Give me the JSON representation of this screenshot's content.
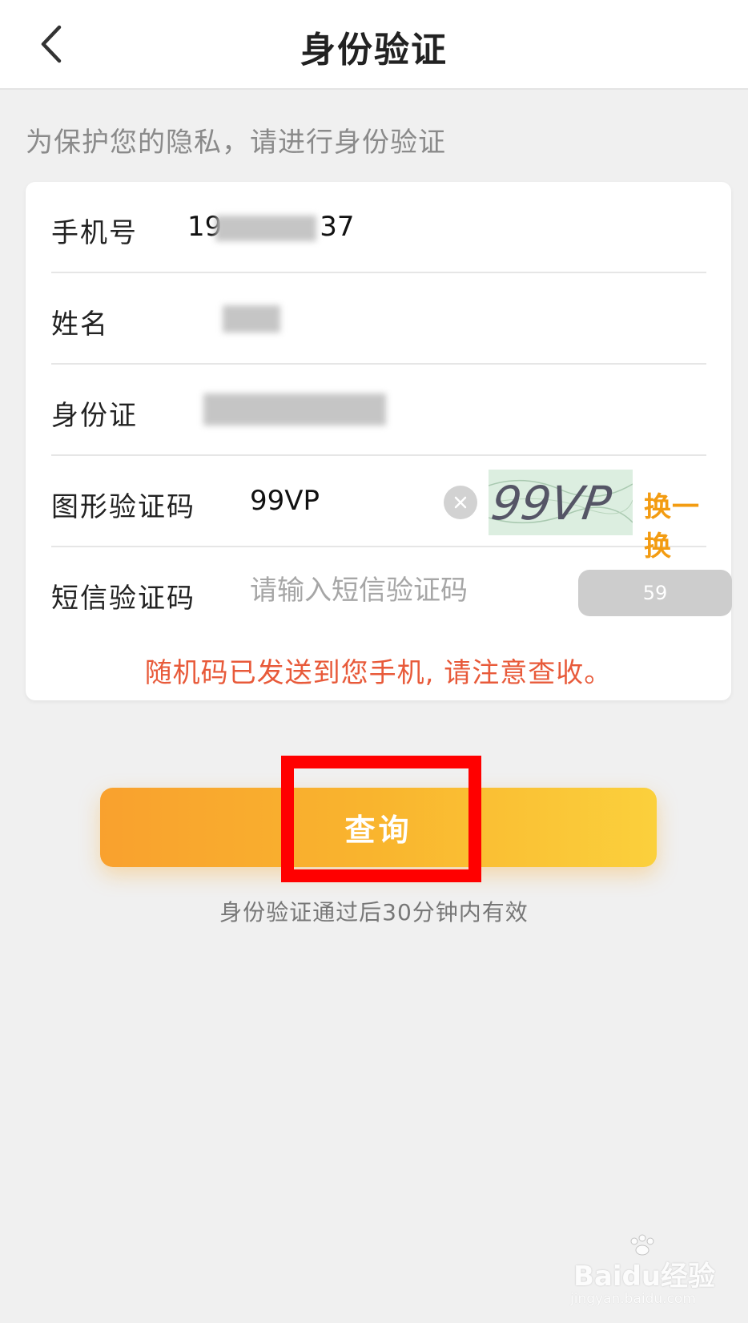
{
  "navbar": {
    "title": "身份验证",
    "back_icon": "chevron-left-icon"
  },
  "subtitle": "为保护您的隐私，请进行身份验证",
  "form": {
    "phone": {
      "label": "手机号",
      "value_prefix": "19",
      "value_suffix": "37"
    },
    "name": {
      "label": "姓名"
    },
    "id_card": {
      "label": "身份证"
    },
    "captcha": {
      "label": "图形验证码",
      "value": "99VP",
      "clear_icon": "clear-icon",
      "image_text": "99VP",
      "refresh_label": "换一换"
    },
    "sms": {
      "label": "短信验证码",
      "placeholder": "请输入短信验证码",
      "countdown": "59"
    },
    "sent_message": "随机码已发送到您手机, 请注意查收。"
  },
  "query_button": {
    "label": "查询"
  },
  "validity_note": "身份验证通过后30分钟内有效",
  "watermark": {
    "main": "Baidu经验",
    "sub": "jingyan.baidu.com"
  },
  "colors": {
    "accent_orange": "#f39c12",
    "error_red": "#e85a3a",
    "button_gradient_start": "#f9a12e",
    "button_gradient_end": "#fbd03c",
    "highlight_red": "#ff0000"
  }
}
